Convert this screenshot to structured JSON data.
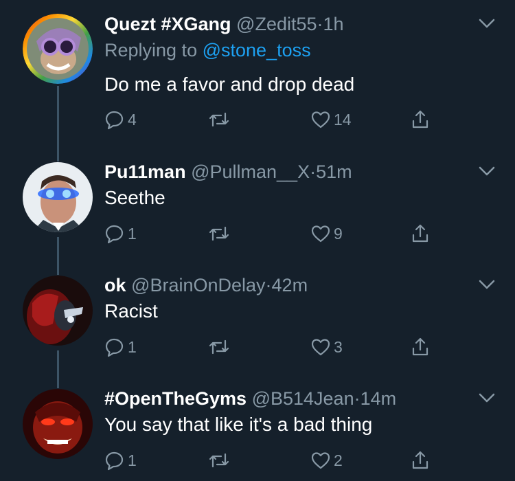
{
  "tweets": [
    {
      "name": "Quezt #XGang",
      "handle": "@Zedit55",
      "time": "1h",
      "replying_prefix": "Replying to ",
      "replying_handle": "@stone_toss",
      "text": "Do me a favor and drop dead",
      "replies": "4",
      "likes": "14"
    },
    {
      "name": "Pu11man",
      "handle": "@Pullman__X",
      "time": "51m",
      "text": "Seethe",
      "replies": "1",
      "likes": "9"
    },
    {
      "name": "ok",
      "handle": "@BrainOnDelay",
      "time": "42m",
      "text": "Racist",
      "replies": "1",
      "likes": "3"
    },
    {
      "name": "#OpenTheGyms",
      "handle": "@B514Jean",
      "time": "14m",
      "text": "You say that like it's a bad thing",
      "replies": "1",
      "likes": "2"
    }
  ],
  "separator": "·",
  "icons": {
    "reply": "reply-icon",
    "retweet": "retweet-icon",
    "like": "heart-icon",
    "share": "share-icon",
    "more": "chevron-down-icon"
  },
  "colors": {
    "background": "#15202b",
    "text_primary": "#ffffff",
    "text_secondary": "#8899a6",
    "link": "#1da1f2",
    "thread_line": "#3d5466"
  }
}
